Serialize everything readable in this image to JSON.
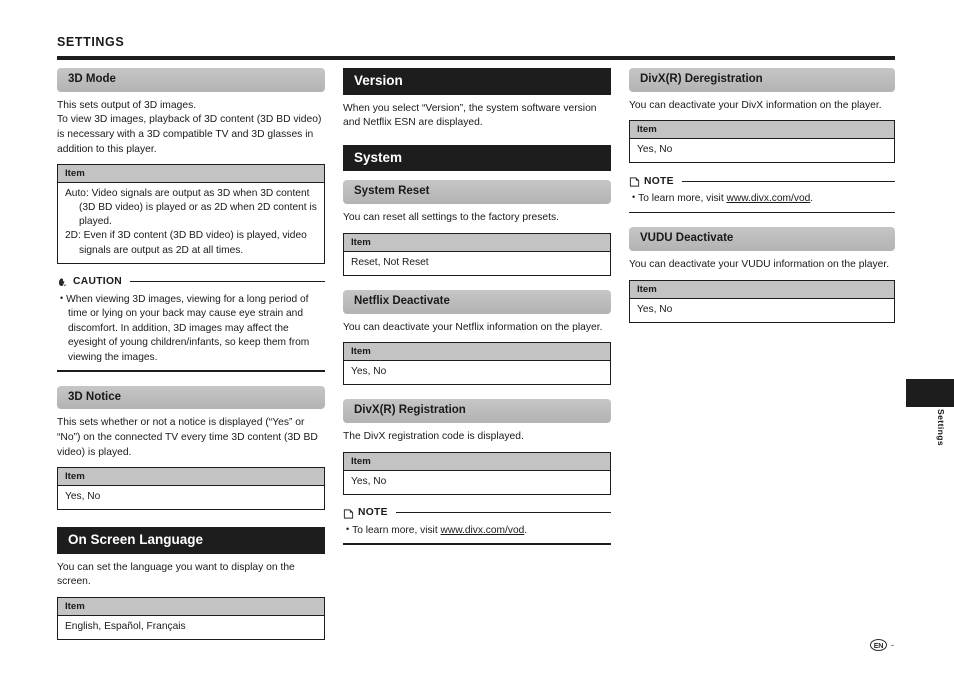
{
  "header": {
    "title": "SETTINGS"
  },
  "columns": {
    "left": {
      "sections": [
        {
          "id": "3d-mode",
          "heading": "3D Mode",
          "heading_style": "gray",
          "body": "This sets output of 3D images.\nTo view 3D images, playback of 3D content (3D BD video) is necessary with a 3D compatible TV and 3D glasses in addition to this player.",
          "table": {
            "column_header": "Item",
            "rows": [
              "Auto: Video signals are output as 3D when 3D content (3D BD video) is played or as 2D when 2D content is played.",
              "2D: Even if 3D content (3D BD video) is played, video signals are output as 2D at all times."
            ]
          }
        },
        {
          "id": "3d-notice",
          "heading": "3D Notice",
          "heading_style": "gray",
          "body": "This sets whether or not a notice is displayed (“Yes” or “No”) on the connected TV every time 3D content (3D BD video) is played.",
          "table": {
            "column_header": "Item",
            "rows": [
              "Yes, No"
            ]
          }
        },
        {
          "id": "on-screen-language",
          "heading": "On Screen Language",
          "heading_style": "black",
          "body": "You can set the language you want to display on the screen.",
          "table": {
            "column_header": "Item",
            "rows": [
              "English, Español, Français"
            ]
          }
        }
      ],
      "caution": {
        "icon": "hand-caution-icon",
        "label": "CAUTION",
        "bullet": "•",
        "text": "When viewing 3D images, viewing for a long period of time or lying on your back may cause eye strain and discomfort. In addition, 3D images may affect the eyesight of young children/infants, so keep them from viewing the images."
      }
    },
    "middle": {
      "sections": [
        {
          "id": "version",
          "heading": "Version",
          "heading_style": "black",
          "body": "When you select “Version”, the system software version and Netflix ESN are displayed."
        },
        {
          "id": "system",
          "heading": "System",
          "heading_style": "black"
        },
        {
          "id": "system-reset",
          "heading": "System Reset",
          "heading_style": "gray",
          "body": "You can reset all settings to the factory presets.",
          "table": {
            "column_header": "Item",
            "rows": [
              "Reset, Not Reset"
            ]
          }
        },
        {
          "id": "netflix-deactivate",
          "heading": "Netflix Deactivate",
          "heading_style": "gray",
          "body": "You can deactivate your Netflix information on the player.",
          "table": {
            "column_header": "Item",
            "rows": [
              "Yes, No"
            ]
          }
        },
        {
          "id": "divx-registration",
          "heading": "DivX(R) Registration",
          "heading_style": "gray",
          "body": "The DivX registration code is displayed.",
          "table": {
            "column_header": "Item",
            "rows": [
              "Yes, No"
            ]
          }
        }
      ],
      "note": {
        "icon": "note-page-icon",
        "label": "NOTE",
        "bullet": "•",
        "text_before": "To learn more, visit ",
        "link": "www.divx.com/vod",
        "text_after": "."
      }
    },
    "right": {
      "sections": [
        {
          "id": "divx-deregistration",
          "heading": "DivX(R) Deregistration",
          "heading_style": "gray",
          "body": "You can deactivate your DivX information on the player.",
          "table": {
            "column_header": "Item",
            "rows": [
              "Yes, No"
            ]
          }
        },
        {
          "id": "vudu-deactivate",
          "heading": "VUDU Deactivate",
          "heading_style": "gray",
          "body": "You can deactivate your VUDU information on the player.",
          "table": {
            "column_header": "Item",
            "rows": [
              "Yes, No"
            ]
          }
        }
      ],
      "note": {
        "icon": "note-page-icon",
        "label": "NOTE",
        "bullet": "•",
        "text_before": "To learn more, visit ",
        "link": "www.divx.com/vod",
        "text_after": "."
      }
    }
  },
  "edge_tab": {
    "label": "Settings"
  },
  "footer": {
    "language_badge": "EN",
    "page_mark": "-"
  },
  "colors": {
    "black_bar": "#1d1d1d",
    "gray_bar": "#bdbdbd",
    "table_header": "#c3c3c3",
    "text": "#1a1a1a"
  }
}
